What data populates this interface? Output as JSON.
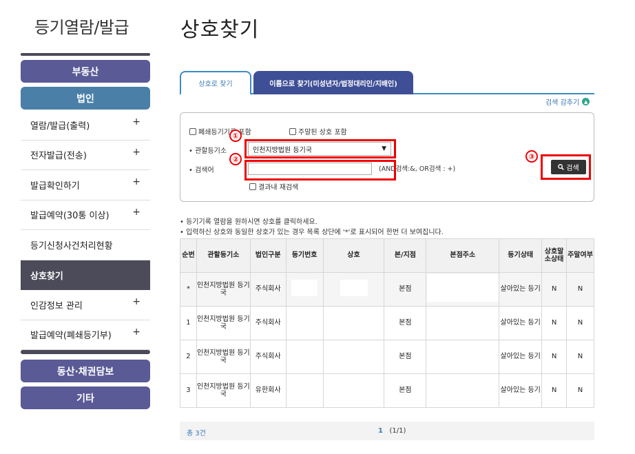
{
  "sidebar": {
    "title": "등기열람/발급",
    "categories": [
      "부동산",
      "법인",
      "동산·채권담보",
      "기타"
    ],
    "items": [
      {
        "label": "열람/발급(출력)",
        "plus": "+"
      },
      {
        "label": "전자발급(전송)",
        "plus": "+"
      },
      {
        "label": "발급확인하기",
        "plus": "+"
      },
      {
        "label": "발급예약(30통 이상)",
        "plus": "+"
      },
      {
        "label": "등기신청사건처리현황",
        "plus": ""
      },
      {
        "label": "상호찾기",
        "plus": ""
      },
      {
        "label": "인감정보 관리",
        "plus": "+"
      },
      {
        "label": "발급예약(폐쇄등기부)",
        "plus": "+"
      }
    ]
  },
  "page_title": "상호찾기",
  "tabs": [
    "상호로 찾기",
    "이름으로 찾기(미성년자/법정대리인/지배인)"
  ],
  "collapse_label": "검색 감추기",
  "search": {
    "closed_label": "폐쇄등기기록 포함",
    "dormant_label": "주말된 상호 포함",
    "registry_label": "• 관할등기소",
    "registry_value": "인천지방법원 등기국",
    "keyword_label": "• 검색어",
    "keyword_value": "",
    "hint": "(AND검색:&, OR검색 : +)",
    "research_label": "결과내 재검색",
    "button_label": "검색",
    "markers": [
      "①",
      "②",
      "③"
    ]
  },
  "notes": [
    "• 등기기록 열람을 원하시면 상호를 클릭하세요.",
    "• 입력하신 상호와 동일한 상호가 있는 경우 목록 상단에 '*'로 표시되어 한번 더 보여집니다."
  ],
  "table": {
    "headers": [
      "순번",
      "관할등기소",
      "법인구분",
      "등기번호",
      "상호",
      "본/지점",
      "본점주소",
      "등기상태",
      "상호말소상태",
      "주말여부"
    ],
    "rows": [
      [
        "*",
        "인천지방법원 등기국",
        "주식회사",
        "",
        "",
        "본점",
        "",
        "살아있는 등기",
        "N",
        "N"
      ],
      [
        "1",
        "인천지방법원 등기국",
        "주식회사",
        "",
        "",
        "본점",
        "",
        "살아있는 등기",
        "N",
        "N"
      ],
      [
        "2",
        "인천지방법원 등기국",
        "주식회사",
        "",
        "",
        "본점",
        "",
        "살아있는 등기",
        "N",
        "N"
      ],
      [
        "3",
        "인천지방법원 등기국",
        "유한회사",
        "",
        "",
        "본점",
        "",
        "살아있는 등기",
        "N",
        "N"
      ]
    ]
  },
  "footer": {
    "total": "총 3건",
    "page_current": "1",
    "page_info": "(1/1)"
  }
}
